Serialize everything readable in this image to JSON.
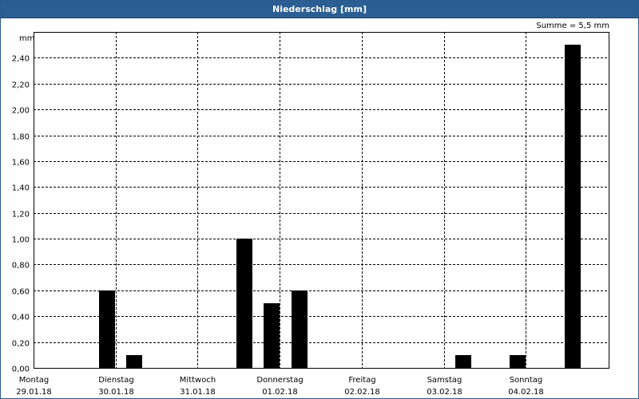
{
  "header": {
    "title": "Niederschlag [mm]"
  },
  "summary": {
    "text": "Summe = 5,5 mm"
  },
  "colors": {
    "titlebar": "#2b5e93",
    "bar": "#000000",
    "grid": "#000000"
  },
  "chart_data": {
    "type": "bar",
    "title": "Niederschlag [mm]",
    "ylabel": "mm",
    "xlabel": "",
    "ylim": [
      0,
      2.6
    ],
    "y_ticks": [
      "0,00",
      "0,20",
      "0,40",
      "0,60",
      "0,80",
      "1,00",
      "1,20",
      "1,40",
      "1,60",
      "1,80",
      "2,00",
      "2,20",
      "2,40"
    ],
    "x_ticks": [
      {
        "day": "Montag",
        "date": "29.01.18"
      },
      {
        "day": "Dienstag",
        "date": "30.01.18"
      },
      {
        "day": "Mittwoch",
        "date": "31.01.18"
      },
      {
        "day": "Donnerstag",
        "date": "01.02.18"
      },
      {
        "day": "Freitag",
        "date": "02.02.18"
      },
      {
        "day": "Samstag",
        "date": "03.02.18"
      },
      {
        "day": "Sonntag",
        "date": "04.02.18"
      }
    ],
    "bars": [
      {
        "day_offset": 0.9,
        "value": 0.6
      },
      {
        "day_offset": 1.23,
        "value": 0.1
      },
      {
        "day_offset": 2.57,
        "value": 1.0
      },
      {
        "day_offset": 2.9,
        "value": 0.5
      },
      {
        "day_offset": 3.24,
        "value": 0.6
      },
      {
        "day_offset": 5.24,
        "value": 0.1
      },
      {
        "day_offset": 5.9,
        "value": 0.1
      },
      {
        "day_offset": 6.57,
        "value": 2.5
      }
    ],
    "grid": true,
    "summary": "Summe = 5,5 mm"
  }
}
